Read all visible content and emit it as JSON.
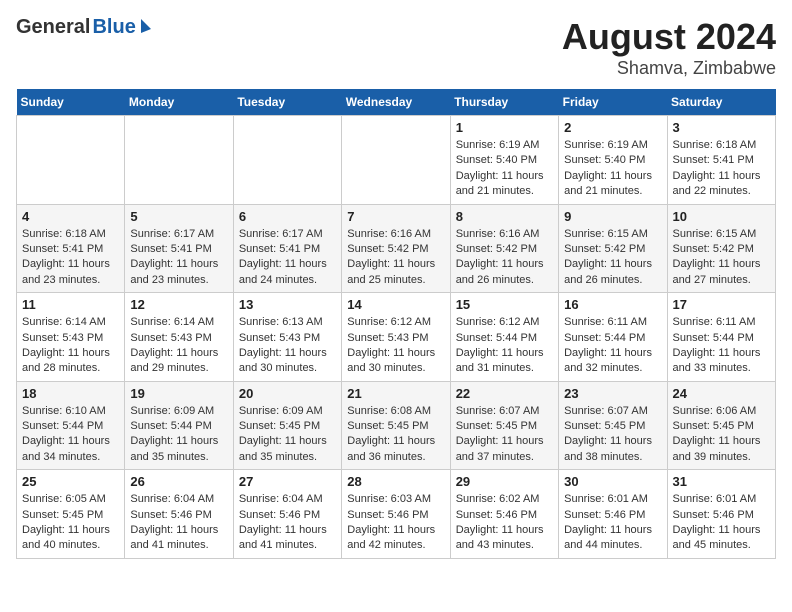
{
  "header": {
    "logo_general": "General",
    "logo_blue": "Blue",
    "title_month": "August 2024",
    "title_location": "Shamva, Zimbabwe"
  },
  "days_of_week": [
    "Sunday",
    "Monday",
    "Tuesday",
    "Wednesday",
    "Thursday",
    "Friday",
    "Saturday"
  ],
  "weeks": [
    [
      {
        "day": "",
        "content": ""
      },
      {
        "day": "",
        "content": ""
      },
      {
        "day": "",
        "content": ""
      },
      {
        "day": "",
        "content": ""
      },
      {
        "day": "1",
        "content": "Sunrise: 6:19 AM\nSunset: 5:40 PM\nDaylight: 11 hours and 21 minutes."
      },
      {
        "day": "2",
        "content": "Sunrise: 6:19 AM\nSunset: 5:40 PM\nDaylight: 11 hours and 21 minutes."
      },
      {
        "day": "3",
        "content": "Sunrise: 6:18 AM\nSunset: 5:41 PM\nDaylight: 11 hours and 22 minutes."
      }
    ],
    [
      {
        "day": "4",
        "content": "Sunrise: 6:18 AM\nSunset: 5:41 PM\nDaylight: 11 hours and 23 minutes."
      },
      {
        "day": "5",
        "content": "Sunrise: 6:17 AM\nSunset: 5:41 PM\nDaylight: 11 hours and 23 minutes."
      },
      {
        "day": "6",
        "content": "Sunrise: 6:17 AM\nSunset: 5:41 PM\nDaylight: 11 hours and 24 minutes."
      },
      {
        "day": "7",
        "content": "Sunrise: 6:16 AM\nSunset: 5:42 PM\nDaylight: 11 hours and 25 minutes."
      },
      {
        "day": "8",
        "content": "Sunrise: 6:16 AM\nSunset: 5:42 PM\nDaylight: 11 hours and 26 minutes."
      },
      {
        "day": "9",
        "content": "Sunrise: 6:15 AM\nSunset: 5:42 PM\nDaylight: 11 hours and 26 minutes."
      },
      {
        "day": "10",
        "content": "Sunrise: 6:15 AM\nSunset: 5:42 PM\nDaylight: 11 hours and 27 minutes."
      }
    ],
    [
      {
        "day": "11",
        "content": "Sunrise: 6:14 AM\nSunset: 5:43 PM\nDaylight: 11 hours and 28 minutes."
      },
      {
        "day": "12",
        "content": "Sunrise: 6:14 AM\nSunset: 5:43 PM\nDaylight: 11 hours and 29 minutes."
      },
      {
        "day": "13",
        "content": "Sunrise: 6:13 AM\nSunset: 5:43 PM\nDaylight: 11 hours and 30 minutes."
      },
      {
        "day": "14",
        "content": "Sunrise: 6:12 AM\nSunset: 5:43 PM\nDaylight: 11 hours and 30 minutes."
      },
      {
        "day": "15",
        "content": "Sunrise: 6:12 AM\nSunset: 5:44 PM\nDaylight: 11 hours and 31 minutes."
      },
      {
        "day": "16",
        "content": "Sunrise: 6:11 AM\nSunset: 5:44 PM\nDaylight: 11 hours and 32 minutes."
      },
      {
        "day": "17",
        "content": "Sunrise: 6:11 AM\nSunset: 5:44 PM\nDaylight: 11 hours and 33 minutes."
      }
    ],
    [
      {
        "day": "18",
        "content": "Sunrise: 6:10 AM\nSunset: 5:44 PM\nDaylight: 11 hours and 34 minutes."
      },
      {
        "day": "19",
        "content": "Sunrise: 6:09 AM\nSunset: 5:44 PM\nDaylight: 11 hours and 35 minutes."
      },
      {
        "day": "20",
        "content": "Sunrise: 6:09 AM\nSunset: 5:45 PM\nDaylight: 11 hours and 35 minutes."
      },
      {
        "day": "21",
        "content": "Sunrise: 6:08 AM\nSunset: 5:45 PM\nDaylight: 11 hours and 36 minutes."
      },
      {
        "day": "22",
        "content": "Sunrise: 6:07 AM\nSunset: 5:45 PM\nDaylight: 11 hours and 37 minutes."
      },
      {
        "day": "23",
        "content": "Sunrise: 6:07 AM\nSunset: 5:45 PM\nDaylight: 11 hours and 38 minutes."
      },
      {
        "day": "24",
        "content": "Sunrise: 6:06 AM\nSunset: 5:45 PM\nDaylight: 11 hours and 39 minutes."
      }
    ],
    [
      {
        "day": "25",
        "content": "Sunrise: 6:05 AM\nSunset: 5:45 PM\nDaylight: 11 hours and 40 minutes."
      },
      {
        "day": "26",
        "content": "Sunrise: 6:04 AM\nSunset: 5:46 PM\nDaylight: 11 hours and 41 minutes."
      },
      {
        "day": "27",
        "content": "Sunrise: 6:04 AM\nSunset: 5:46 PM\nDaylight: 11 hours and 41 minutes."
      },
      {
        "day": "28",
        "content": "Sunrise: 6:03 AM\nSunset: 5:46 PM\nDaylight: 11 hours and 42 minutes."
      },
      {
        "day": "29",
        "content": "Sunrise: 6:02 AM\nSunset: 5:46 PM\nDaylight: 11 hours and 43 minutes."
      },
      {
        "day": "30",
        "content": "Sunrise: 6:01 AM\nSunset: 5:46 PM\nDaylight: 11 hours and 44 minutes."
      },
      {
        "day": "31",
        "content": "Sunrise: 6:01 AM\nSunset: 5:46 PM\nDaylight: 11 hours and 45 minutes."
      }
    ]
  ]
}
